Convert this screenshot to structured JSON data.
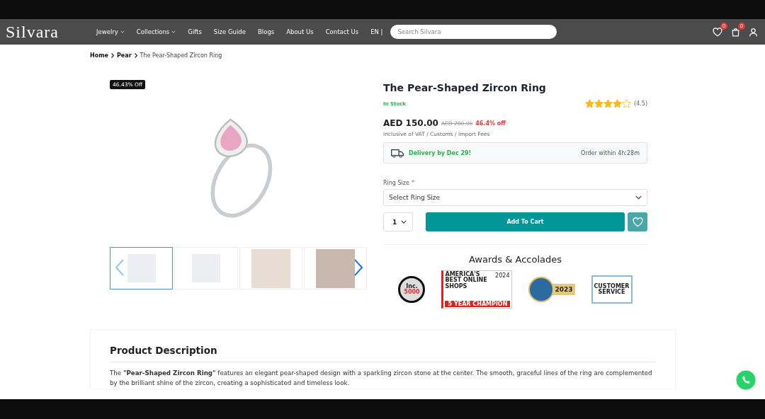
{
  "header": {
    "logo": "Silvara",
    "nav": [
      {
        "label": "Jewelry",
        "dropdown": true
      },
      {
        "label": "Collections",
        "dropdown": true
      },
      {
        "label": "Gifts",
        "dropdown": false
      },
      {
        "label": "Size Guide",
        "dropdown": false
      },
      {
        "label": "Blogs",
        "dropdown": false
      },
      {
        "label": "About Us",
        "dropdown": false
      },
      {
        "label": "Contact Us",
        "dropdown": false
      },
      {
        "label": "EN |",
        "dropdown": false
      }
    ],
    "search": {
      "placeholder": "Search Silvara"
    },
    "wishlist_count": "0",
    "cart_count": "0"
  },
  "breadcrumb": [
    {
      "label": "Home",
      "current": false
    },
    {
      "label": "Pear",
      "current": false
    },
    {
      "label": "The Pear-Shaped Zircon Ring",
      "current": true
    }
  ],
  "gallery": {
    "badge": "46.43% Off",
    "thumbnails": [
      {
        "selected": true
      },
      {
        "selected": false
      },
      {
        "selected": false
      },
      {
        "selected": false
      }
    ]
  },
  "product": {
    "title": "The Pear-Shaped Zircon Ring",
    "stock": "In Stock",
    "stars": 4,
    "rating": "(4.5)",
    "price": "AED 150.00",
    "old_price": "AED 280.00",
    "discount": "46.4% off",
    "tax_note": "Inclusive of VAT / Customs / Import Fees",
    "delivery": "Delivery by Dec 29!",
    "order_within": "Order within 4h:28m",
    "size_label": "Ring Size",
    "size_required": "*",
    "size_select": {
      "placeholder": "Select Ring Size"
    },
    "quantity": "1",
    "add_to_cart": "Add To Cart"
  },
  "awards": {
    "title": "Awards & Accolades",
    "items": [
      {
        "kind": "inc",
        "lines": [
          "Inc.",
          "5000"
        ]
      },
      {
        "kind": "newsweek",
        "lines": [
          "AMERICA'S BEST ONLINE SHOPS",
          "2024",
          "5 YEAR CHAMPION"
        ]
      },
      {
        "kind": "circle",
        "lines": [
          "2023"
        ]
      },
      {
        "kind": "service",
        "lines": [
          "CUSTOMER SERVICE"
        ]
      }
    ]
  },
  "description": {
    "title": "Product Description",
    "text": "The **\"Pear-Shaped Zircon Ring\"** features an elegant pear-shaped design with a sparkling zircon stone at the center. The smooth, graceful lines of the ring are complemented by the brilliant shine of the zircon, creating a sophisticated and timeless look."
  }
}
